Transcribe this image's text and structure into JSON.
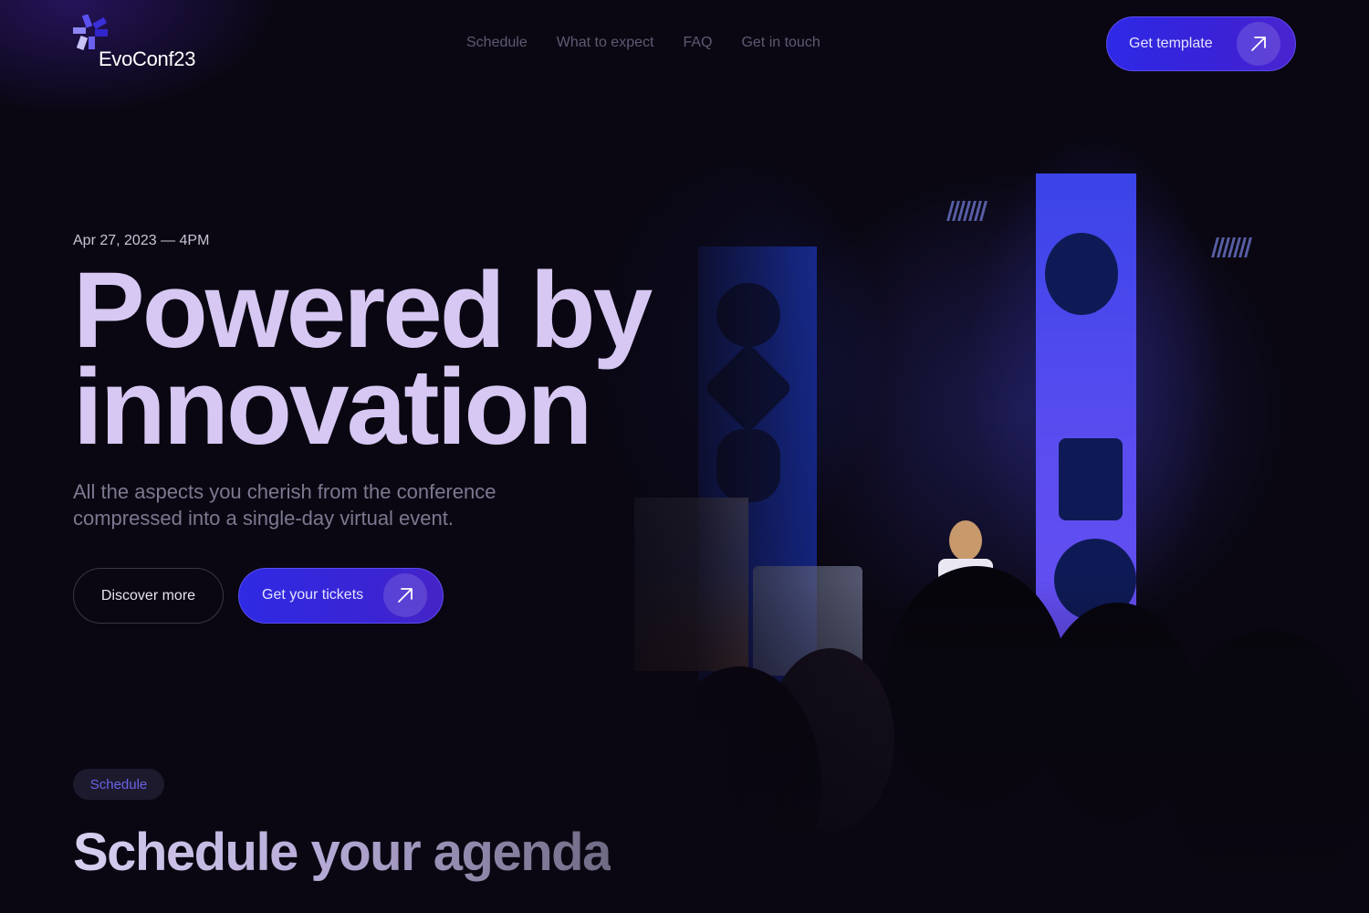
{
  "brand": {
    "name": "EvoConf23",
    "logo_icon": "asterisk-logo-icon"
  },
  "nav": {
    "items": [
      {
        "label": "Schedule"
      },
      {
        "label": "What to expect"
      },
      {
        "label": "FAQ"
      },
      {
        "label": "Get in touch"
      }
    ]
  },
  "header": {
    "cta_label": "Get template",
    "cta_icon": "arrow-up-right-icon"
  },
  "hero": {
    "date": "Apr 27, 2023 — 4PM",
    "headline_line1": "Powered by",
    "headline_line2": "innovation",
    "subtitle": "All the aspects you cherish from the conference compressed into a single-day virtual event.",
    "secondary_button": "Discover more",
    "primary_button": "Get your tickets",
    "primary_icon": "arrow-up-right-icon",
    "background_image": "conference-stage-photo"
  },
  "schedule": {
    "tag": "Schedule",
    "title": "Schedule your agenda"
  },
  "colors": {
    "background": "#0a0712",
    "accent": "#2e29e6",
    "headline": "#d6c8f2",
    "muted": "#7d7890",
    "nav": "#5f5a73",
    "tag_text": "#6a63e6"
  }
}
